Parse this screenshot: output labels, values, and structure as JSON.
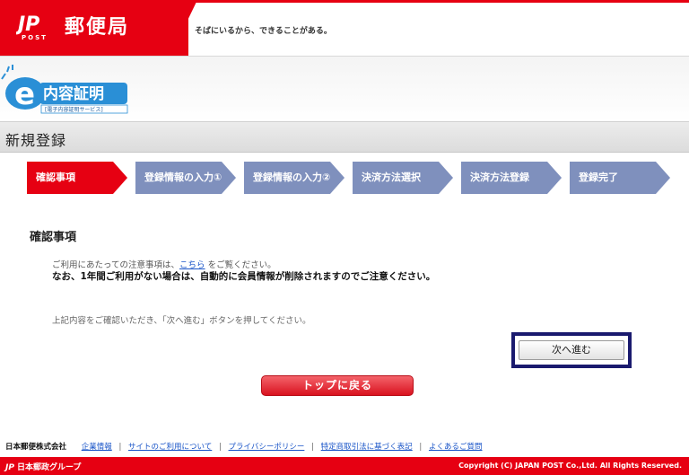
{
  "header": {
    "brand_name": "郵便局",
    "logo_mark": "JP",
    "logo_sub": "POST",
    "tagline": "そばにいるから、できることがある。",
    "brand_color": "#e60012"
  },
  "service": {
    "logo_letter": "e",
    "logo_text": "内容証明",
    "logo_subtext": "[電子内容証明サービス]"
  },
  "page": {
    "title": "新規登録"
  },
  "steps": [
    {
      "label": "確認事項",
      "active": true,
      "color": "#e60012"
    },
    {
      "label": "登録情報の入力①",
      "active": false,
      "color": "#7f90bd"
    },
    {
      "label": "登録情報の入力②",
      "active": false,
      "color": "#7f90bd"
    },
    {
      "label": "決済方法選択",
      "active": false,
      "color": "#7f90bd"
    },
    {
      "label": "決済方法登録",
      "active": false,
      "color": "#7f90bd"
    },
    {
      "label": "登録完了",
      "active": false,
      "color": "#7f90bd"
    }
  ],
  "content": {
    "section_title": "確認事項",
    "notice_prefix": "ご利用にあたっての注意事項は、",
    "notice_link": "こちら",
    "notice_suffix": " をご覧ください。",
    "notice_bold": "なお、1年間ご利用がない場合は、自動的に会員情報が削除されますのでご注意ください。",
    "instruction": "上記内容をご確認いただき、「次へ進む」ボタンを押してください。",
    "next_button": "次へ進む",
    "top_button": "トップに戻る"
  },
  "footer": {
    "company": "日本郵便株式会社",
    "links": [
      "企業情報",
      "サイトのご利用について",
      "プライバシーポリシー",
      "特定商取引法に基づく表記",
      "よくあるご質問"
    ],
    "group": "日本郵政グループ",
    "group_mark": "JP",
    "copyright": "Copyright (C) JAPAN POST Co.,Ltd.  All Rights Reserved."
  }
}
